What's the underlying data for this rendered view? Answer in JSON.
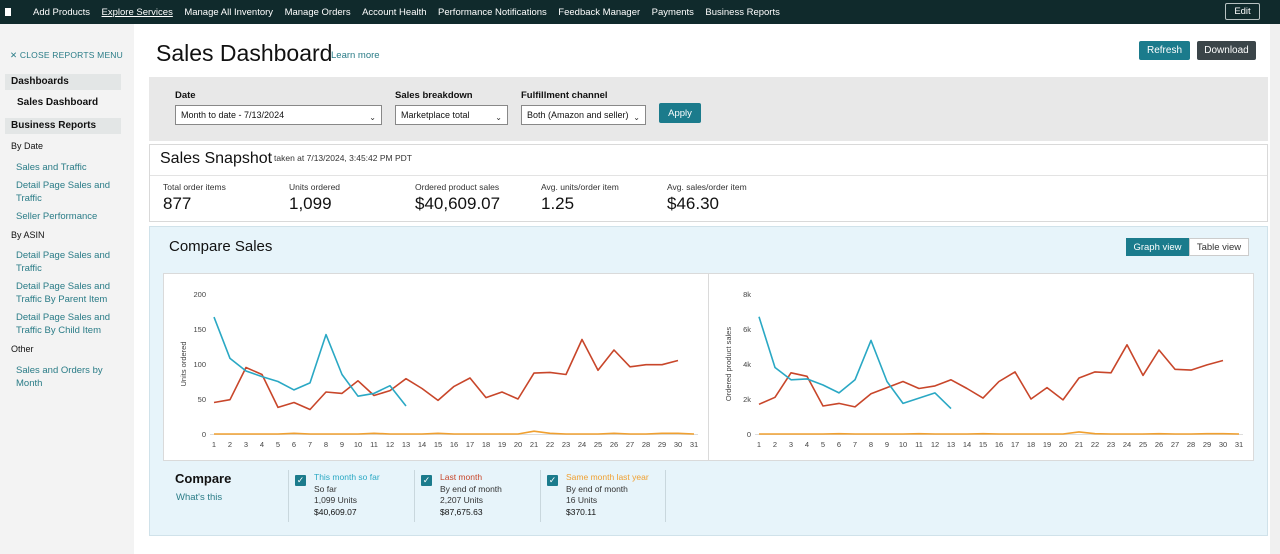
{
  "topnav": {
    "items": [
      "Add Products",
      "Explore Services",
      "Manage All Inventory",
      "Manage Orders",
      "Account Health",
      "Performance Notifications",
      "Feedback Manager",
      "Payments",
      "Business Reports"
    ],
    "edit_label": "Edit"
  },
  "sidebar": {
    "close_label": "✕  CLOSE REPORTS MENU",
    "dashboards_header": "Dashboards",
    "sales_dashboard": "Sales Dashboard",
    "business_reports_header": "Business Reports",
    "by_date": "By Date",
    "by_date_links": [
      "Sales and Traffic",
      "Detail Page Sales and Traffic",
      "Seller Performance"
    ],
    "by_asin": "By ASIN",
    "by_asin_links": [
      "Detail Page Sales and Traffic",
      "Detail Page Sales and Traffic By Parent Item",
      "Detail Page Sales and Traffic By Child Item"
    ],
    "other": "Other",
    "other_links": [
      "Sales and Orders by Month"
    ]
  },
  "header": {
    "title": "Sales Dashboard",
    "learn_more": "Learn more",
    "refresh": "Refresh",
    "download": "Download"
  },
  "filters": {
    "date_label": "Date",
    "date_value": "Month to date - 7/13/2024",
    "breakdown_label": "Sales breakdown",
    "breakdown_value": "Marketplace total",
    "fulfillment_label": "Fulfillment channel",
    "fulfillment_value": "Both (Amazon and seller)",
    "apply": "Apply"
  },
  "snapshot": {
    "title": "Sales Snapshot",
    "taken_at": "taken at 7/13/2024, 3:45:42 PM PDT",
    "metrics": [
      {
        "label": "Total order items",
        "value": "877"
      },
      {
        "label": "Units ordered",
        "value": "1,099"
      },
      {
        "label": "Ordered product sales",
        "value": "$40,609.07"
      },
      {
        "label": "Avg. units/order item",
        "value": "1.25"
      },
      {
        "label": "Avg. sales/order item",
        "value": "$46.30"
      }
    ]
  },
  "compare": {
    "title": "Compare Sales",
    "graph_view": "Graph view",
    "table_view": "Table view",
    "compare_label": "Compare",
    "whats_this": "What's this",
    "legend": [
      {
        "name": "This month so far",
        "line1": "So far",
        "line2": "1,099 Units",
        "line3": "$40,609.07",
        "color": "#2aa8c4"
      },
      {
        "name": "Last month",
        "line1": "By end of month",
        "line2": "2,207 Units",
        "line3": "$87,675.63",
        "color": "#c8462a"
      },
      {
        "name": "Same month last year",
        "line1": "By end of month",
        "line2": "16 Units",
        "line3": "$370.11",
        "color": "#f0a030"
      }
    ]
  },
  "chart_data": [
    {
      "type": "line",
      "title": "",
      "xlabel": "",
      "ylabel": "Units ordered",
      "ylim": [
        0,
        200
      ],
      "yticks": [
        "0",
        "50",
        "100",
        "150",
        "200"
      ],
      "x": [
        1,
        2,
        3,
        4,
        5,
        6,
        7,
        8,
        9,
        10,
        11,
        12,
        13,
        14,
        15,
        16,
        17,
        18,
        19,
        20,
        21,
        22,
        23,
        24,
        25,
        26,
        27,
        28,
        29,
        30,
        31
      ],
      "series": [
        {
          "name": "This month so far",
          "color": "#2aa8c4",
          "values": [
            167,
            108,
            90,
            82,
            75,
            63,
            73,
            142,
            85,
            54,
            58,
            69,
            40
          ]
        },
        {
          "name": "Last month",
          "color": "#c8462a",
          "values": [
            45,
            49,
            95,
            85,
            38,
            45,
            35,
            60,
            58,
            76,
            55,
            62,
            79,
            65,
            48,
            68,
            80,
            52,
            60,
            50,
            87,
            88,
            85,
            135,
            91,
            120,
            96,
            99,
            99,
            105
          ]
        },
        {
          "name": "Same month last year",
          "color": "#f0a030",
          "values": [
            0,
            0,
            0,
            0,
            0,
            1,
            0,
            0,
            0,
            0,
            1,
            0,
            0,
            0,
            1,
            0,
            0,
            0,
            0,
            0,
            4,
            1,
            0,
            0,
            0,
            1,
            0,
            0,
            1,
            1,
            0
          ]
        }
      ]
    },
    {
      "type": "line",
      "title": "",
      "xlabel": "",
      "ylabel": "Ordered product sales",
      "ylim": [
        0,
        8000
      ],
      "yticks": [
        "0",
        "2k",
        "4k",
        "6k",
        "8k"
      ],
      "x": [
        1,
        2,
        3,
        4,
        5,
        6,
        7,
        8,
        9,
        10,
        11,
        12,
        13,
        14,
        15,
        16,
        17,
        18,
        19,
        20,
        21,
        22,
        23,
        24,
        25,
        26,
        27,
        28,
        29,
        30,
        31
      ],
      "series": [
        {
          "name": "This month so far",
          "color": "#2aa8c4",
          "values": [
            6700,
            3800,
            3100,
            3150,
            2800,
            2350,
            3100,
            5350,
            3000,
            1750,
            2050,
            2350,
            1450
          ]
        },
        {
          "name": "Last month",
          "color": "#c8462a",
          "values": [
            1700,
            2100,
            3500,
            3300,
            1600,
            1750,
            1550,
            2300,
            2650,
            3000,
            2600,
            2750,
            3100,
            2600,
            2050,
            3000,
            3550,
            2000,
            2650,
            1950,
            3200,
            3550,
            3500,
            5100,
            3350,
            4800,
            3700,
            3650,
            3950,
            4200
          ]
        },
        {
          "name": "Same month last year",
          "color": "#f0a030",
          "values": [
            0,
            0,
            0,
            0,
            0,
            20,
            0,
            0,
            0,
            0,
            20,
            0,
            0,
            0,
            20,
            0,
            0,
            0,
            0,
            0,
            120,
            20,
            0,
            0,
            0,
            20,
            0,
            0,
            20,
            20,
            0
          ]
        }
      ]
    }
  ]
}
